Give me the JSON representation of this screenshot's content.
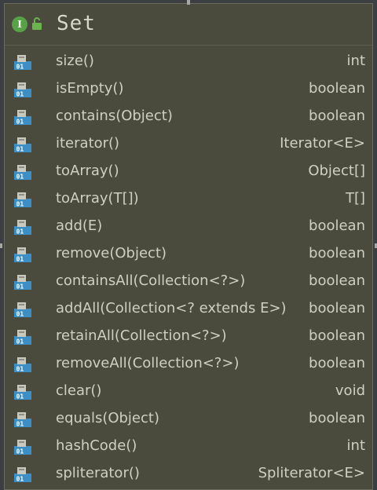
{
  "header": {
    "interface_icon_letter": "I",
    "title": "Set"
  },
  "methods": [
    {
      "name": "size()",
      "type": "int"
    },
    {
      "name": "isEmpty()",
      "type": "boolean"
    },
    {
      "name": "contains(Object)",
      "type": "boolean"
    },
    {
      "name": "iterator()",
      "type": "Iterator<E>"
    },
    {
      "name": "toArray()",
      "type": "Object[]"
    },
    {
      "name": "toArray(T[])",
      "type": "T[]"
    },
    {
      "name": "add(E)",
      "type": "boolean"
    },
    {
      "name": "remove(Object)",
      "type": "boolean"
    },
    {
      "name": "containsAll(Collection<?>)",
      "type": "boolean"
    },
    {
      "name": "addAll(Collection<? extends E>)",
      "type": "boolean"
    },
    {
      "name": "retainAll(Collection<?>)",
      "type": "boolean"
    },
    {
      "name": "removeAll(Collection<?>)",
      "type": "boolean"
    },
    {
      "name": "clear()",
      "type": "void"
    },
    {
      "name": "equals(Object)",
      "type": "boolean"
    },
    {
      "name": "hashCode()",
      "type": "int"
    },
    {
      "name": "spliterator()",
      "type": "Spliterator<E>"
    }
  ],
  "icons": {
    "method": "abstract-method-icon",
    "interface": "interface-icon",
    "visibility": "public-lock-icon"
  },
  "colors": {
    "panel_bg": "#4a4a3d",
    "text": "#cfcfc3",
    "interface_icon": "#57a246",
    "method_icon": "#3b8fc4"
  }
}
